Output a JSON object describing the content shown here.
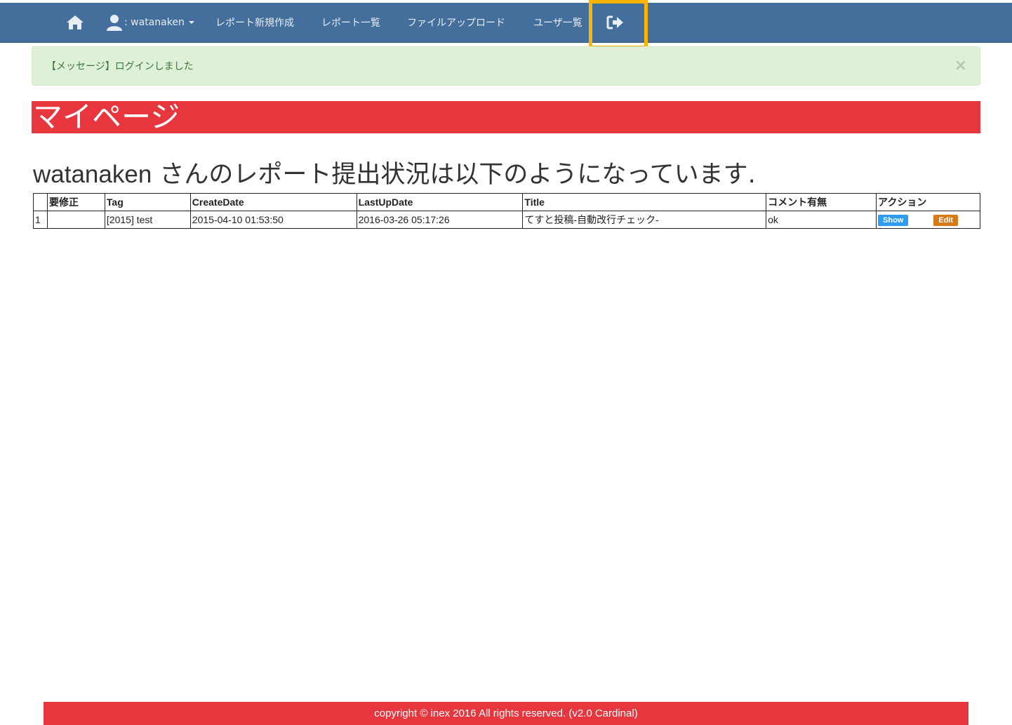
{
  "navbar": {
    "home_icon": "home-icon",
    "user_icon": "user-icon",
    "username": ": watanaken",
    "items": [
      {
        "label": "レポート新規作成"
      },
      {
        "label": "レポート一覧"
      },
      {
        "label": "ファイルアップロード"
      },
      {
        "label": "ユーザ一覧"
      }
    ],
    "logout_icon": "logout-icon",
    "color": "#446e9b",
    "highlight_color": "#ffb400"
  },
  "alert": {
    "message": "【メッセージ】ログインしました",
    "close": "×"
  },
  "title": "マイページ",
  "subtitle": {
    "username": "watanaken",
    "text": " さんのレポート提出状況は以下のようになっています."
  },
  "table": {
    "headers": [
      "",
      "要修正",
      "Tag",
      "CreateDate",
      "LastUpDate",
      "Title",
      "コメント有無",
      "アクション"
    ],
    "rows": [
      {
        "no": "1",
        "fix": "",
        "tag": "[2015] test",
        "create": "2015-04-10 01:53:50",
        "update": "2016-03-26 05:17:26",
        "title": "てすと投稿-自動改行チェック-",
        "comment": "ok",
        "show": "Show",
        "edit": "Edit"
      }
    ]
  },
  "footer": "copyright © inex 2016 All rights reserved. (v2.0 Cardinal)",
  "colors": {
    "accent_red": "#e8363e",
    "alert_bg": "#dff0d8",
    "show_btn": "#2d9cf2",
    "edit_btn": "#d67916"
  }
}
